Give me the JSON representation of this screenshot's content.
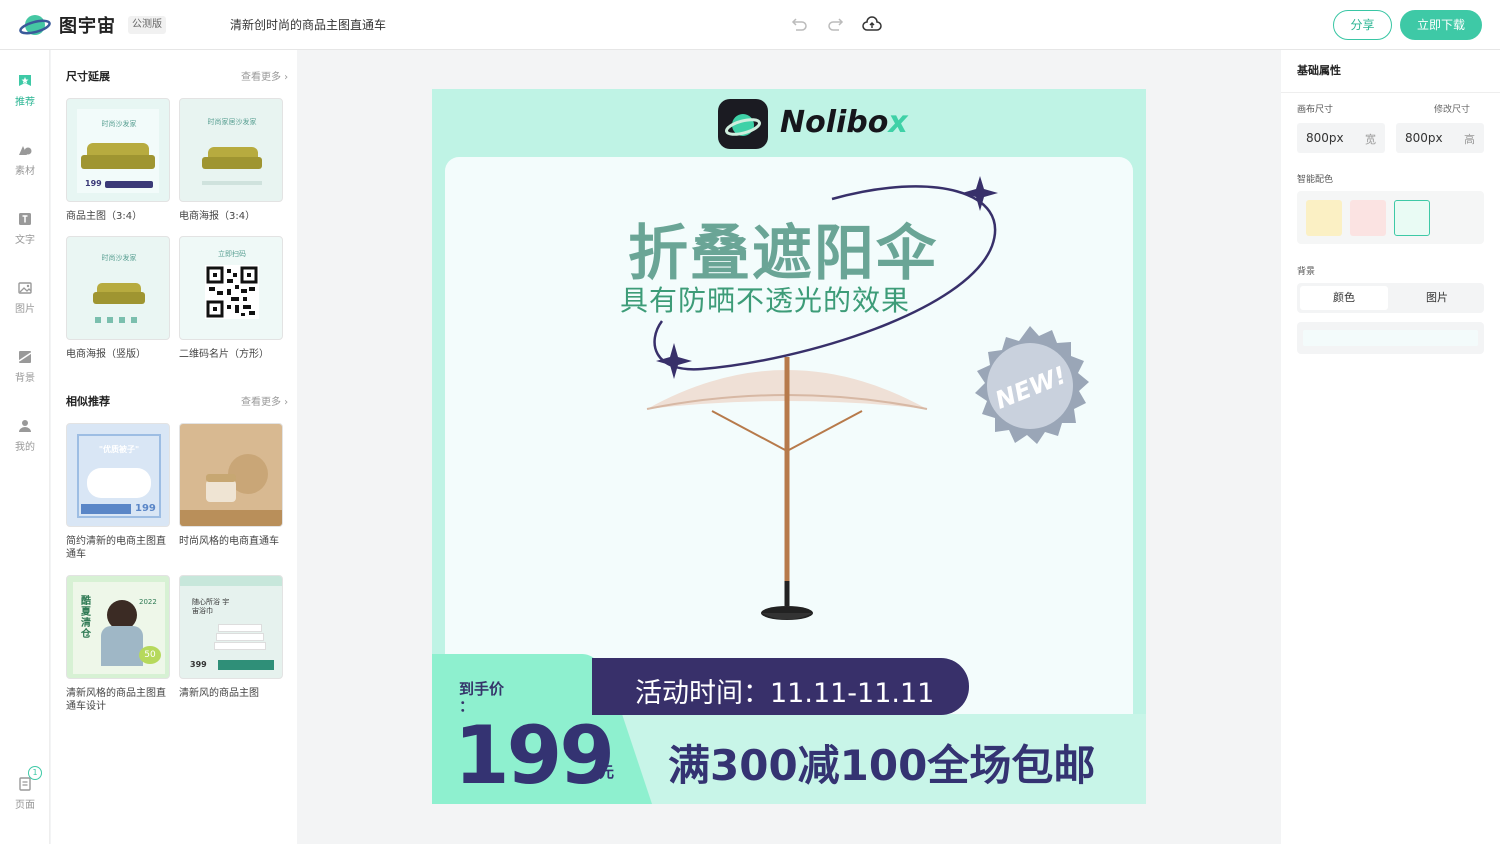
{
  "header": {
    "brand": "图宇宙",
    "beta_badge": "公测版",
    "doc_title": "清新创时尚的商品主图直通车",
    "share_label": "分享",
    "download_label": "立即下载"
  },
  "rail": {
    "items": [
      {
        "label": "推荐",
        "icon": "recommend-icon"
      },
      {
        "label": "素材",
        "icon": "shapes-icon"
      },
      {
        "label": "文字",
        "icon": "text-icon"
      },
      {
        "label": "图片",
        "icon": "image-icon"
      },
      {
        "label": "背景",
        "icon": "background-icon"
      },
      {
        "label": "我的",
        "icon": "user-icon"
      }
    ],
    "pages_label": "页面",
    "page_count": "1"
  },
  "panel": {
    "section1": {
      "title": "尺寸延展",
      "more": "查看更多",
      "cards": [
        {
          "label": "商品主图（3:4）"
        },
        {
          "label": "电商海报（3:4）"
        },
        {
          "label": "电商海报（竖版）"
        },
        {
          "label": "二维码名片（方形）"
        }
      ]
    },
    "section2": {
      "title": "相似推荐",
      "more": "查看更多",
      "cards": [
        {
          "label": "简约清新的电商主图直通车"
        },
        {
          "label": "时尚风格的电商直通车"
        },
        {
          "label": "清新风格的商品主图直通车设计"
        },
        {
          "label": "清新风的商品主图"
        }
      ]
    },
    "thumb_texts": {
      "sofa1_title": "时尚沙发家",
      "sofa1_price": "199",
      "sofa2_title": "时尚家居沙发家",
      "sofa3_title": "时尚沙发家",
      "qr_title": "立即扫码",
      "quilt_title": "\"优质被子\"",
      "quilt_price": "199",
      "summer_title": "酷夏清仓",
      "summer_year": "2022",
      "summer_pct": "50",
      "towel_title": "随心所浴 宇宙浴巾",
      "towel_price": "399"
    }
  },
  "poster": {
    "brand_word": "Nolibo",
    "brand_x": "x",
    "headline": "折叠遮阳伞",
    "subline": "具有防晒不透光的效果",
    "badge": "NEW!",
    "price_label": "到手价",
    "price_colon": "：",
    "price": "199",
    "price_unit": "元",
    "time_text": "活动时间：11.11-11.11",
    "promo": "满300减100全场包邮"
  },
  "props": {
    "title": "基础属性",
    "canvas_size_label": "画布尺寸",
    "edit_size_label": "修改尺寸",
    "width_value": "800px",
    "width_unit": "宽",
    "height_value": "800px",
    "height_unit": "高",
    "smart_color_label": "智能配色",
    "swatches": [
      "#fbf0c4",
      "#fbe3e2",
      "#e9fbf4"
    ],
    "background_label": "背景",
    "tab_color": "颜色",
    "tab_image": "图片"
  },
  "colors": {
    "accent": "#3ec9a6",
    "poster_bg": "#bff3e5",
    "navy": "#343372"
  }
}
